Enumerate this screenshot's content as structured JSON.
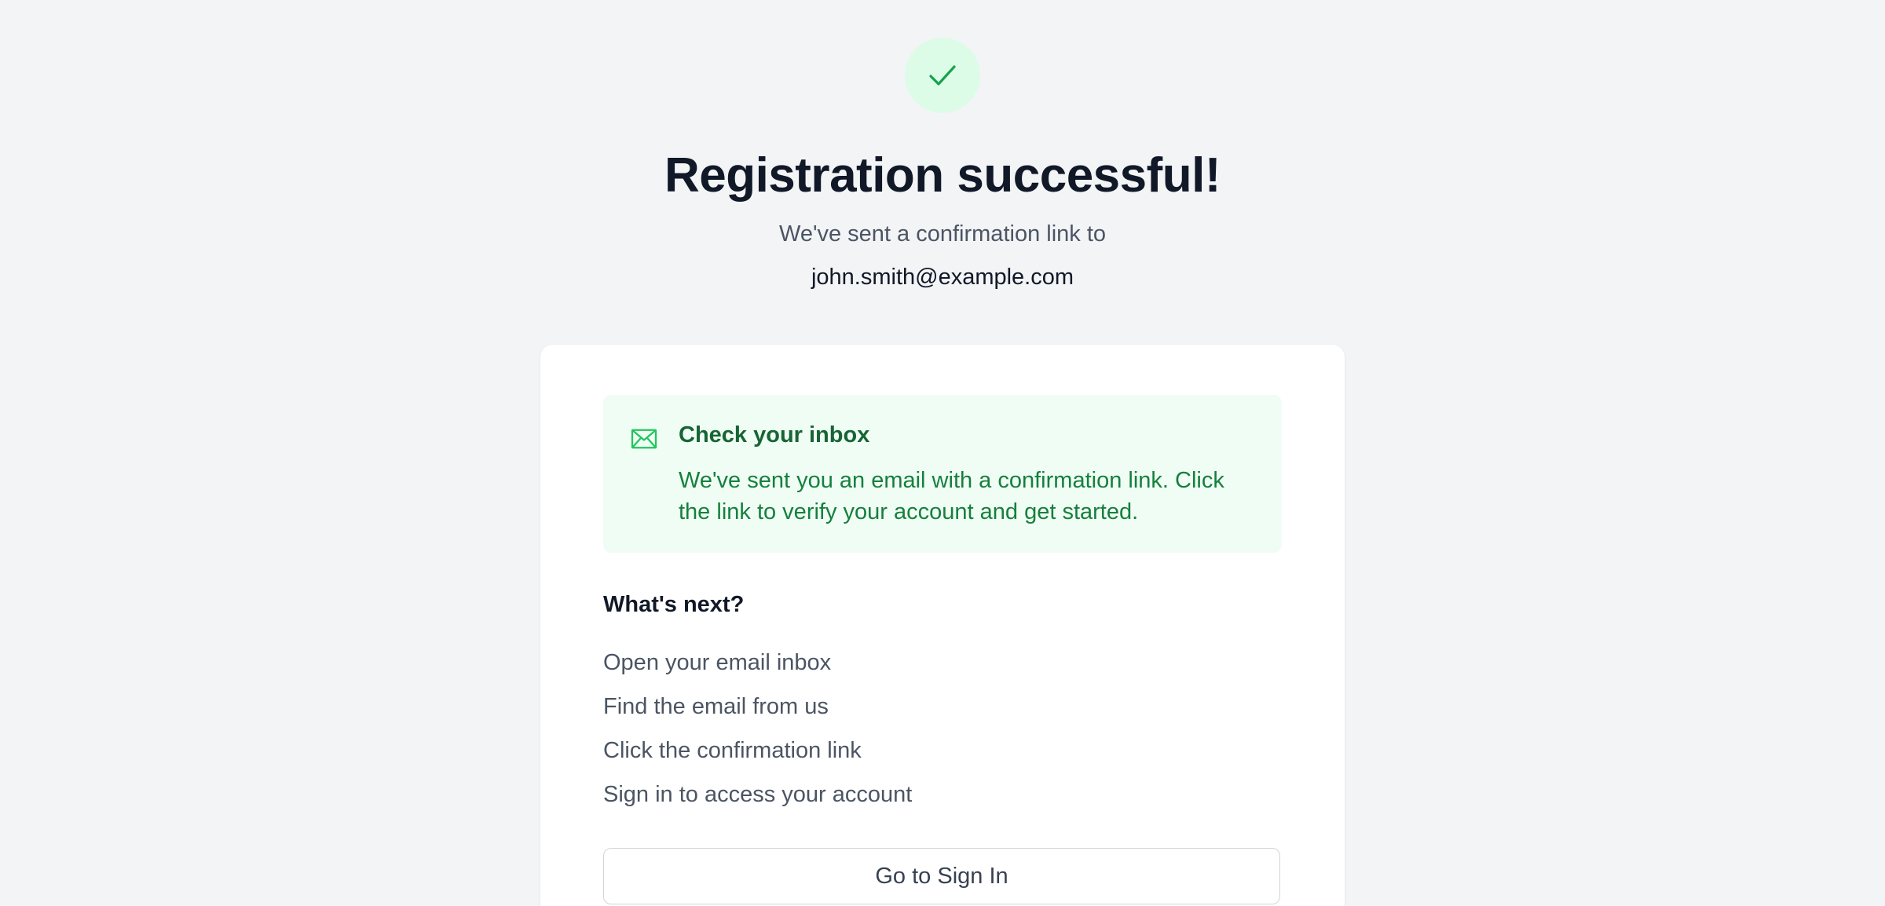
{
  "header": {
    "badge_icon": "check-icon",
    "title": "Registration successful!",
    "subtitle": "We've sent a confirmation link to",
    "email": "john.smith@example.com"
  },
  "alert": {
    "icon": "mail-icon",
    "title": "Check your inbox",
    "body": "We've sent you an email with a confirmation link. Click the link to verify your account and get started."
  },
  "next": {
    "heading": "What's next?",
    "steps": [
      "Open your email inbox",
      "Find the email from us",
      "Click the confirmation link",
      "Sign in to access your account"
    ]
  },
  "actions": {
    "signin_label": "Go to Sign In"
  },
  "colors": {
    "background": "#f3f4f6",
    "success_light": "#dcfce7",
    "success": "#16a34a",
    "alert_bg": "#f0fdf4",
    "alert_title": "#166534",
    "alert_text": "#15803d"
  }
}
